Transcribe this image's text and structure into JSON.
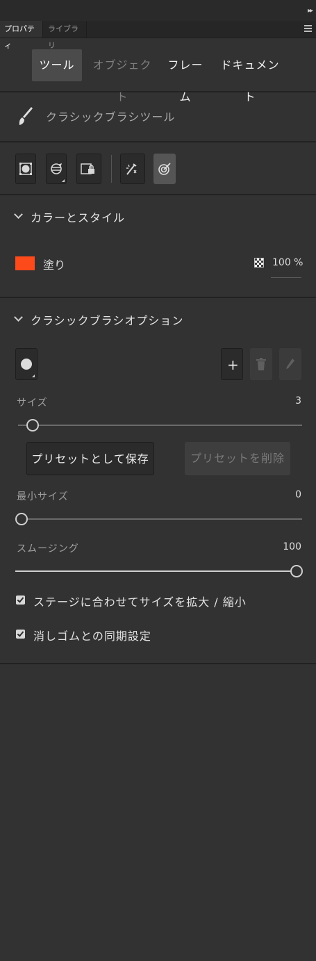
{
  "panel": {
    "tabs": [
      "プロパティ",
      "ライブラリ"
    ]
  },
  "modes": [
    "ツール",
    "オブジェクト",
    "フレーム",
    "ドキュメント"
  ],
  "tool": {
    "name": "クラシックブラシツール"
  },
  "color_section": {
    "title": "カラーとスタイル",
    "fill_label": "塗り",
    "fill_color": "#fc4a1a",
    "opacity": "100 %"
  },
  "brush_section": {
    "title": "クラシックブラシオプション",
    "size": {
      "label": "サイズ",
      "value": "3",
      "level": 0.03
    },
    "save_preset": "プリセットとして保存",
    "delete_preset": "プリセットを削除",
    "min_size": {
      "label": "最小サイズ",
      "value": "0",
      "level": 0.0
    },
    "smoothing": {
      "label": "スムージング",
      "value": "100",
      "level": 1.0
    },
    "scale_check": {
      "label": "ステージに合わせてサイズを拡大 / 縮小",
      "checked": true
    },
    "eraser_check": {
      "label": "消しゴムとの同期設定",
      "checked": true
    }
  }
}
